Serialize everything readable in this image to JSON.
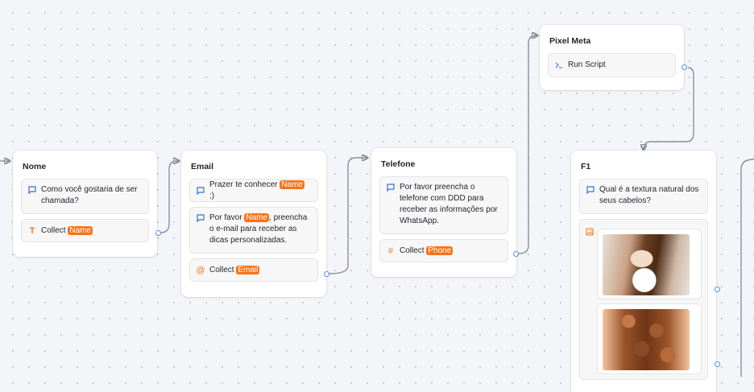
{
  "nodes": {
    "nome": {
      "title": "Nome",
      "text_block": "Como você gostaria de ser chamada?",
      "collect_label": "Collect",
      "collect_var": "Name"
    },
    "email": {
      "title": "Email",
      "block1_prefix": "Prazer te conhecer",
      "block1_var": "Name",
      "block1_suffix": ";)",
      "block2_prefix": "Por favor",
      "block2_var": "Name",
      "block2_suffix": ", preencha o e-mail para receber as dicas personalizadas.",
      "collect_label": "Collect",
      "collect_var": "Email"
    },
    "telefone": {
      "title": "Telefone",
      "text_block": "Por favor preencha o telefone com DDD para receber as informações por WhatsApp.",
      "collect_label": "Collect",
      "collect_var": "Phone"
    },
    "pixel": {
      "title": "Pixel Meta",
      "script_label": "Run Script"
    },
    "f1": {
      "title": "F1",
      "text_block": "Qual é a textura natural dos seus cabelos?"
    }
  },
  "icons": {
    "message": "message-icon",
    "text": "text-input-icon",
    "at": "at-sign-icon",
    "hash": "hash-icon",
    "script": "terminal-icon",
    "image": "image-choice-icon"
  },
  "colors": {
    "accent": "#f97316",
    "message_icon": "#3b6fd4",
    "handle": "#5b8def"
  }
}
